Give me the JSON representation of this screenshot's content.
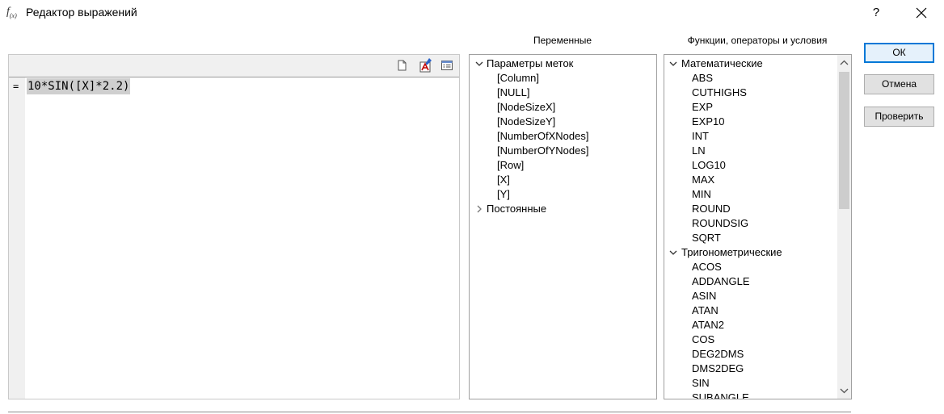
{
  "window": {
    "title_icon": "f(x)",
    "title": "Редактор выражений",
    "help_label": "?",
    "close_icon": "close-icon"
  },
  "headers": {
    "variables": "Переменные",
    "functions": "Функции, операторы и условия"
  },
  "editor": {
    "gutter_marker": "=",
    "expression": "10*SIN([X]*2.2)",
    "toolbar_icons": [
      "new-document-icon",
      "font-icon",
      "properties-icon"
    ]
  },
  "variables": {
    "groups": [
      {
        "label": "Параметры меток",
        "expanded": true,
        "items": [
          "[Column]",
          "[NULL]",
          "[NodeSizeX]",
          "[NodeSizeY]",
          "[NumberOfXNodes]",
          "[NumberOfYNodes]",
          "[Row]",
          "[X]",
          "[Y]"
        ]
      },
      {
        "label": "Постоянные",
        "expanded": false,
        "items": []
      }
    ]
  },
  "functions": {
    "groups": [
      {
        "label": "Математические",
        "expanded": true,
        "items": [
          "ABS",
          "CUTHIGHS",
          "EXP",
          "EXP10",
          "INT",
          "LN",
          "LOG10",
          "MAX",
          "MIN",
          "ROUND",
          "ROUNDSIG",
          "SQRT"
        ]
      },
      {
        "label": "Тригонометрические",
        "expanded": true,
        "items": [
          "ACOS",
          "ADDANGLE",
          "ASIN",
          "ATAN",
          "ATAN2",
          "COS",
          "DEG2DMS",
          "DMS2DEG",
          "SIN",
          "SUBANGLE"
        ]
      }
    ]
  },
  "buttons": {
    "ok": "ОК",
    "cancel": "Отмена",
    "check": "Проверить"
  },
  "colors": {
    "accent": "#0078d7",
    "selection": "#cfcfcf",
    "button_face": "#e1e1e1"
  }
}
